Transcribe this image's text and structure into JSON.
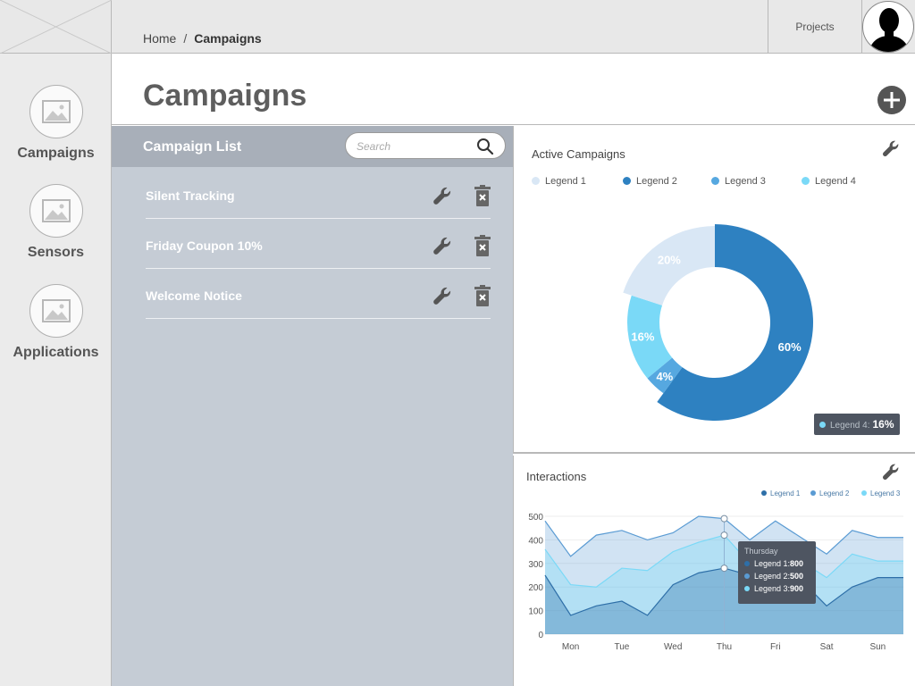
{
  "breadcrumb": {
    "home": "Home",
    "separator": "/",
    "current": "Campaigns"
  },
  "topbar": {
    "projects_label": "Projects"
  },
  "sidebar": {
    "items": [
      {
        "label": "Campaigns",
        "icon": "image-icon"
      },
      {
        "label": "Sensors",
        "icon": "image-icon"
      },
      {
        "label": "Applications",
        "icon": "image-icon"
      }
    ]
  },
  "page": {
    "title": "Campaigns",
    "add_icon": "plus-circle-icon"
  },
  "campaign_list": {
    "title": "Campaign List",
    "search_placeholder": "Search",
    "items": [
      {
        "name": "Silent Tracking"
      },
      {
        "name": "Friday Coupon 10%"
      },
      {
        "name": "Welcome Notice"
      }
    ]
  },
  "active_campaigns": {
    "title": "Active Campaigns",
    "legend": [
      {
        "name": "Legend 1",
        "color": "#d9e7f5"
      },
      {
        "name": "Legend 2",
        "color": "#2e81c1"
      },
      {
        "name": "Legend 3",
        "color": "#56a8e0"
      },
      {
        "name": "Legend 4",
        "color": "#7ad9f7"
      }
    ],
    "tooltip": {
      "label": "Legend 4:",
      "value": "16%",
      "color": "#7ad9f7"
    }
  },
  "interactions": {
    "title": "Interactions",
    "legend": [
      {
        "name": "Legend 1",
        "color": "#2e6fa8"
      },
      {
        "name": "Legend 2",
        "color": "#5a9bd3"
      },
      {
        "name": "Legend 3",
        "color": "#7ad9f7"
      }
    ],
    "tooltip": {
      "title": "Thursday",
      "rows": [
        {
          "label": "Legend 1:",
          "value": "800",
          "color": "#2e6fa8"
        },
        {
          "label": "Legend 2:",
          "value": "500",
          "color": "#5a9bd3"
        },
        {
          "label": "Legend 3:",
          "value": "900",
          "color": "#7ad9f7"
        }
      ]
    }
  },
  "chart_data": [
    {
      "type": "pie",
      "title": "Active Campaigns",
      "donut": true,
      "series": [
        {
          "name": "Legend 1",
          "value": 20,
          "label": "20%",
          "color": "#d9e7f5"
        },
        {
          "name": "Legend 2",
          "value": 60,
          "label": "60%",
          "color": "#2e81c1"
        },
        {
          "name": "Legend 3",
          "value": 4,
          "label": "4%",
          "color": "#56a8e0"
        },
        {
          "name": "Legend 4",
          "value": 16,
          "label": "16%",
          "color": "#7ad9f7"
        }
      ]
    },
    {
      "type": "area",
      "title": "Interactions",
      "ylim": [
        0,
        500
      ],
      "yticks": [
        0,
        100,
        200,
        300,
        400,
        500
      ],
      "categories": [
        "Mon",
        "Tue",
        "Wed",
        "Thu",
        "Fri",
        "Sat",
        "Sun"
      ],
      "x": [
        0,
        0.5,
        1,
        1.5,
        2,
        2.5,
        3,
        3.5,
        4,
        4.5,
        5,
        5.5,
        6,
        6.5,
        7
      ],
      "series": [
        {
          "name": "Legend 2",
          "color": "#5a9bd3",
          "values": [
            480,
            330,
            420,
            440,
            400,
            430,
            500,
            490,
            400,
            480,
            410,
            340,
            440,
            410,
            410
          ]
        },
        {
          "name": "Legend 3",
          "color": "#7ad9f7",
          "values": [
            360,
            210,
            200,
            280,
            270,
            350,
            390,
            420,
            300,
            310,
            310,
            240,
            340,
            310,
            310
          ]
        },
        {
          "name": "Legend 1",
          "color": "#2e6fa8",
          "values": [
            250,
            80,
            120,
            140,
            80,
            210,
            260,
            280,
            250,
            190,
            230,
            120,
            200,
            240,
            240
          ]
        }
      ]
    }
  ]
}
